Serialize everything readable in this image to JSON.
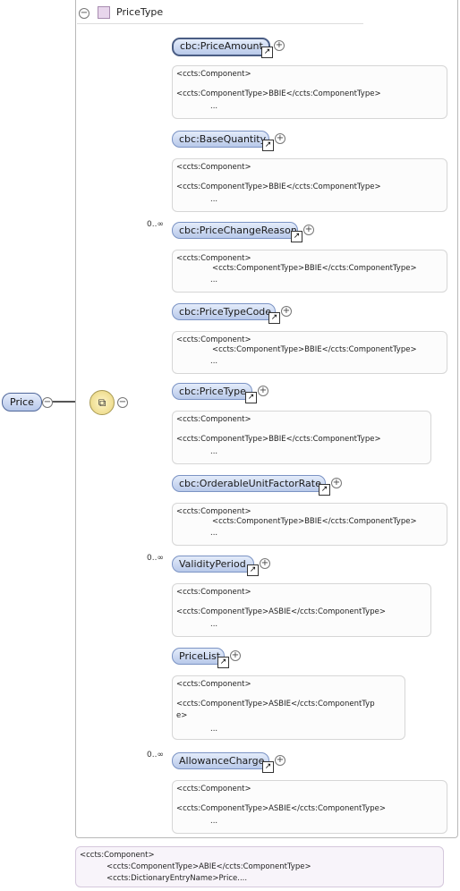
{
  "root": {
    "name": "Price"
  },
  "group": {
    "type_name": "PriceType"
  },
  "annotation_line1": "<ccts:Component>",
  "ellipsis": "...",
  "elements": [
    {
      "name": "cbc:PriceAmount",
      "occurrence": "",
      "bold": true,
      "ann_line2": "<ccts:ComponentType>BBIE</ccts:ComponentType>"
    },
    {
      "name": "cbc:BaseQuantity",
      "occurrence": "",
      "bold": false,
      "ann_line2": "<ccts:ComponentType>BBIE</ccts:ComponentType>"
    },
    {
      "name": "cbc:PriceChangeReason",
      "occurrence": "0..∞",
      "bold": false,
      "ann_line2": "<ccts:ComponentType>BBIE</ccts:ComponentType>"
    },
    {
      "name": "cbc:PriceTypeCode",
      "occurrence": "",
      "bold": false,
      "ann_line2": "<ccts:ComponentType>BBIE</ccts:ComponentType>"
    },
    {
      "name": "cbc:PriceType",
      "occurrence": "",
      "bold": false,
      "ann_line2": "<ccts:ComponentType>BBIE</ccts:ComponentType>"
    },
    {
      "name": "cbc:OrderableUnitFactorRate",
      "occurrence": "",
      "bold": false,
      "ann_line2": "<ccts:ComponentType>BBIE</ccts:ComponentType>"
    },
    {
      "name": "ValidityPeriod",
      "occurrence": "0..∞",
      "bold": false,
      "ann_line2": "<ccts:ComponentType>ASBIE</ccts:ComponentType>"
    },
    {
      "name": "PriceList",
      "occurrence": "",
      "bold": false,
      "ann_line2": "<ccts:ComponentType>ASBIE</ccts:ComponentTyp",
      "ann_line2b": "e>"
    },
    {
      "name": "AllowanceCharge",
      "occurrence": "0..∞",
      "bold": false,
      "ann_line2": "<ccts:ComponentType>ASBIE</ccts:ComponentType>"
    }
  ],
  "bottom_annotation": {
    "line1": "<ccts:Component>",
    "line2": "<ccts:ComponentType>ABIE</ccts:ComponentType>",
    "line3": "<ccts:DictionaryEntryName>Price...."
  },
  "icons": {
    "collapse": "minus-circle-icon",
    "expand": "plus-circle-icon",
    "link": "arrow-link-icon",
    "sequence": "sequence-compositor-icon",
    "complex_type": "complex-type-icon"
  }
}
